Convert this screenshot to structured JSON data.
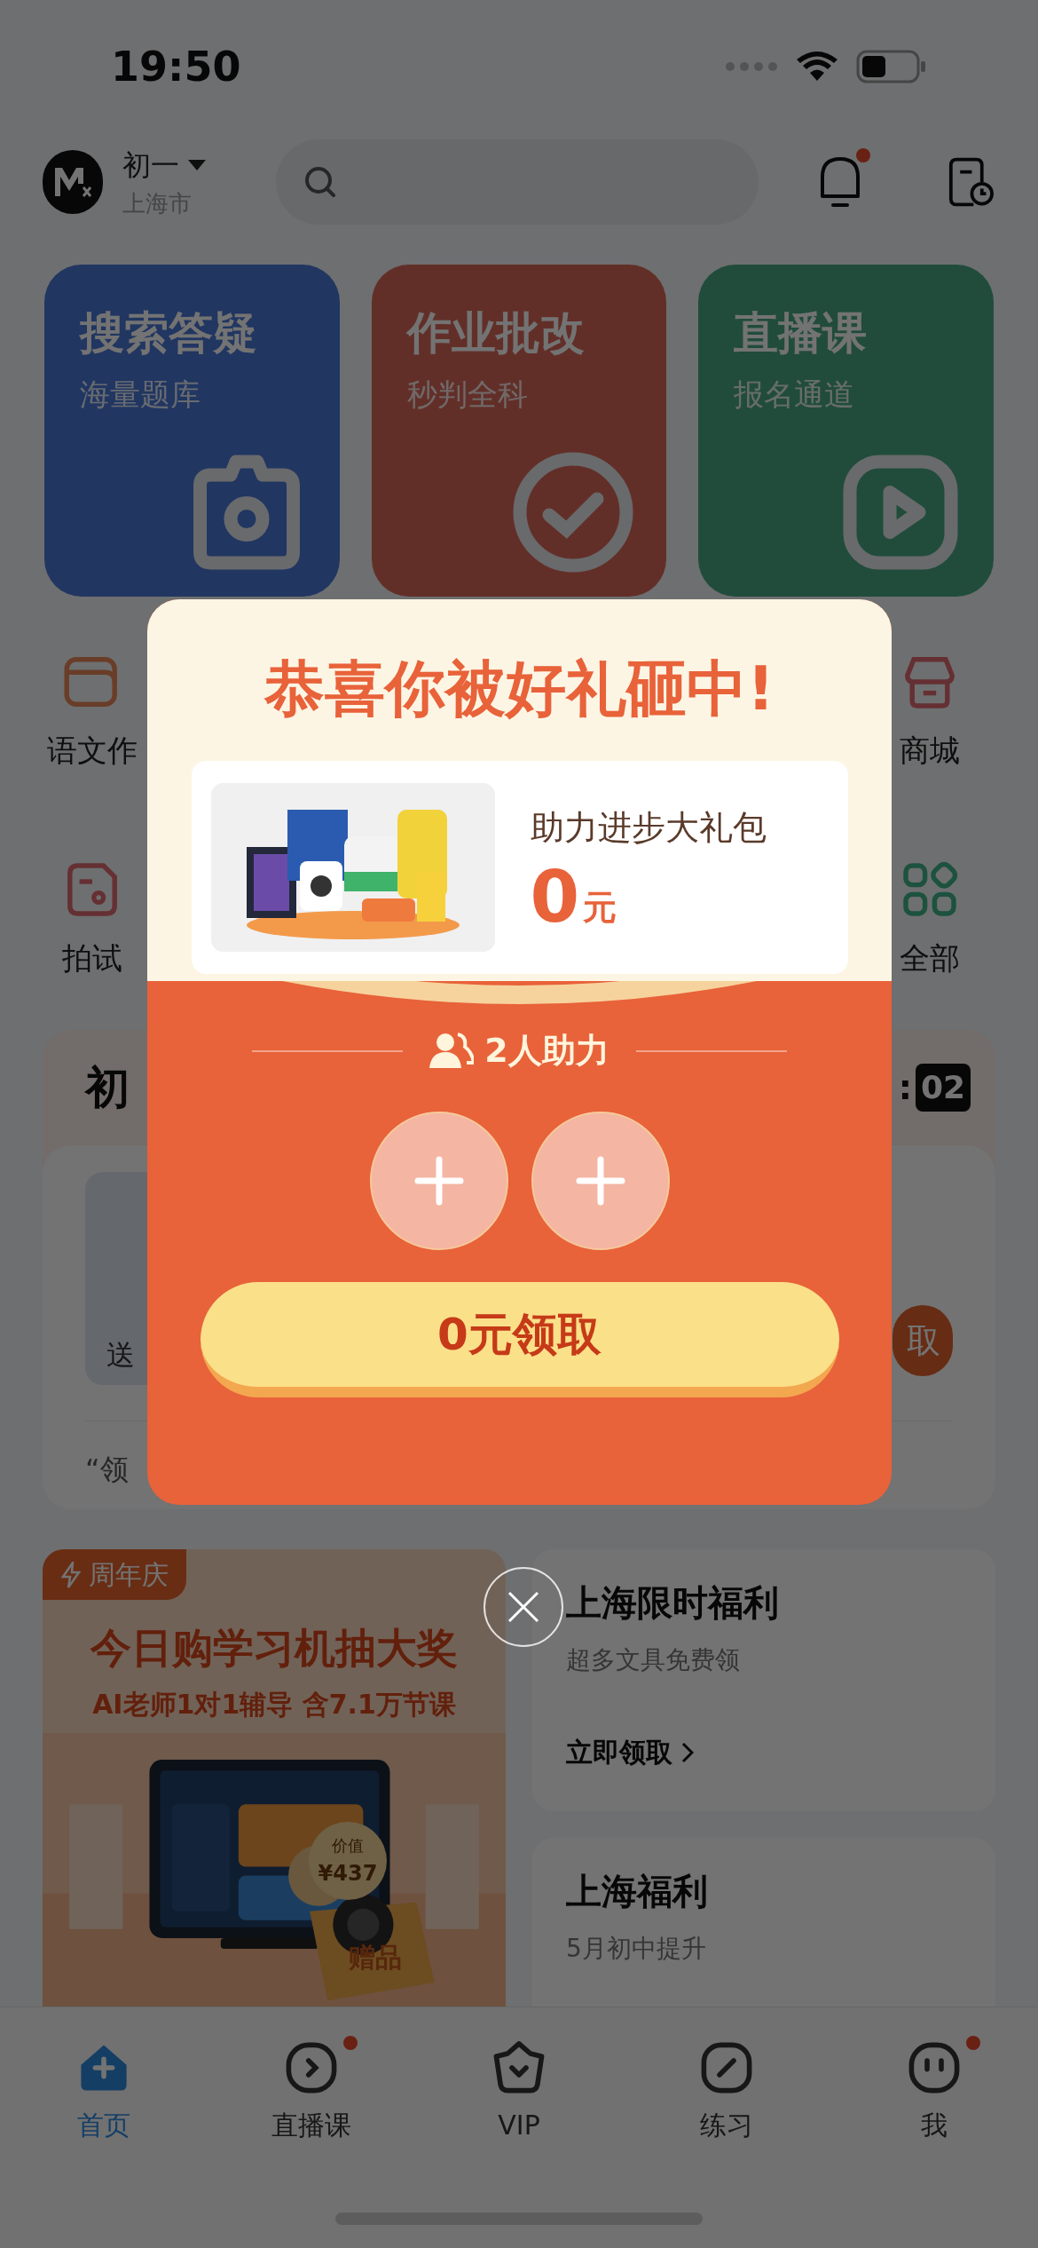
{
  "status_bar": {
    "time": "19:50"
  },
  "header": {
    "grade": "初一",
    "city": "上海市",
    "notification_badge": true
  },
  "tiles": [
    {
      "title": "搜索答疑",
      "subtitle": "海量题库",
      "kind": "camera"
    },
    {
      "title": "作业批改",
      "subtitle": "秒判全科",
      "kind": "check"
    },
    {
      "title": "直播课",
      "subtitle": "报名通道",
      "kind": "play"
    }
  ],
  "shortcuts": [
    {
      "label": "语文作",
      "kind": "book"
    },
    {
      "label": "商城",
      "kind": "shop"
    },
    {
      "label": "拍试"
    },
    {
      "label": "全部",
      "kind": "grid"
    }
  ],
  "section": {
    "title": "初",
    "timer_separator": ":",
    "timer": "02",
    "card_caption": "送",
    "button": "取",
    "note": "“领"
  },
  "promos": {
    "banner": {
      "tag": "周年庆",
      "headline": "今日购学习机抽大奖",
      "subline": "AI老师1对1辅导 含7.1万节课",
      "value_label": "价值",
      "value": "¥437",
      "gift": "赠品"
    },
    "cards": [
      {
        "title": "上海限时福利",
        "subtitle": "超多文具免费领",
        "link": "立即领取"
      },
      {
        "title": "上海福利",
        "subtitle": "5月初中提升"
      }
    ]
  },
  "tabbar": [
    {
      "label": "首页",
      "kind": "home",
      "selected": true,
      "badge": false
    },
    {
      "label": "直播课",
      "kind": "live",
      "selected": false,
      "badge": true
    },
    {
      "label": "VIP",
      "kind": "vip",
      "selected": false,
      "badge": false
    },
    {
      "label": "练习",
      "kind": "practice",
      "selected": false,
      "badge": false
    },
    {
      "label": "我",
      "kind": "me",
      "selected": false,
      "badge": true
    }
  ],
  "modal": {
    "title": "恭喜你被好礼砸中!",
    "gift_name": "助力进步大礼包",
    "price": "0",
    "unit": "元",
    "helpers": "2人助力",
    "slots": [
      {
        "filled": false
      },
      {
        "filled": false
      }
    ],
    "claim_button": "0元领取"
  }
}
